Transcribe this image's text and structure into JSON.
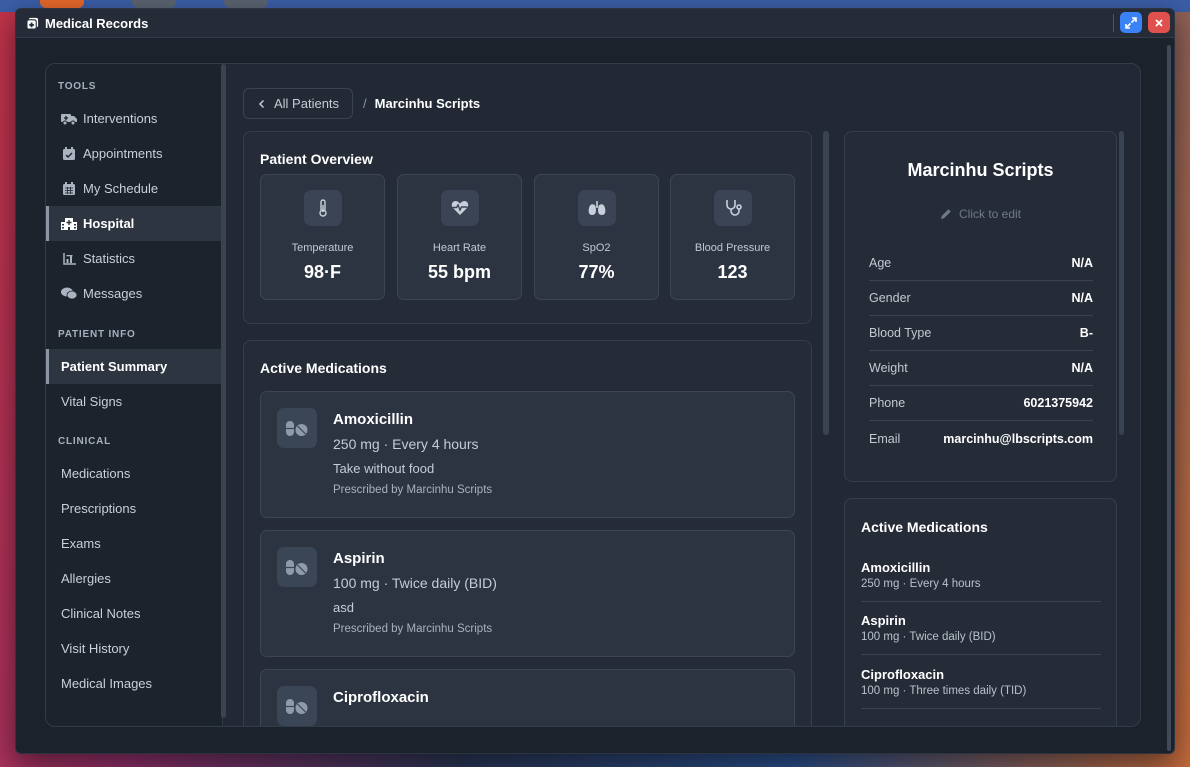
{
  "window": {
    "title": "Medical Records"
  },
  "sidebar": {
    "sections": [
      {
        "title": "TOOLS",
        "items": [
          {
            "label": "Interventions",
            "icon": "ambulance-icon"
          },
          {
            "label": "Appointments",
            "icon": "calendar-check-icon"
          },
          {
            "label": "My Schedule",
            "icon": "calendar-icon"
          },
          {
            "label": "Hospital",
            "icon": "hospital-icon"
          },
          {
            "label": "Statistics",
            "icon": "chart-icon"
          },
          {
            "label": "Messages",
            "icon": "chat-icon"
          }
        ]
      },
      {
        "title": "PATIENT INFO",
        "items": [
          {
            "label": "Patient Summary"
          },
          {
            "label": "Vital Signs"
          }
        ]
      },
      {
        "title": "CLINICAL",
        "items": [
          {
            "label": "Medications"
          },
          {
            "label": "Prescriptions"
          },
          {
            "label": "Exams"
          },
          {
            "label": "Allergies"
          },
          {
            "label": "Clinical Notes"
          },
          {
            "label": "Visit History"
          },
          {
            "label": "Medical Images"
          }
        ]
      }
    ]
  },
  "breadcrumb": {
    "back_label": "All Patients",
    "separator": "/",
    "current": "Marcinhu Scripts"
  },
  "overview": {
    "title": "Patient Overview",
    "vitals": [
      {
        "label": "Temperature",
        "value": "98·F",
        "icon": "thermometer-icon"
      },
      {
        "label": "Heart Rate",
        "value": "55 bpm",
        "icon": "heart-pulse-icon"
      },
      {
        "label": "SpO2",
        "value": "77%",
        "icon": "lungs-icon"
      },
      {
        "label": "Blood Pressure",
        "value": "123",
        "icon": "stethoscope-icon"
      }
    ]
  },
  "medications": {
    "title": "Active Medications",
    "items": [
      {
        "name": "Amoxicillin",
        "dose": "250 mg · Every 4 hours",
        "instructions": "Take without food",
        "prescriber": "Prescribed by Marcinhu Scripts"
      },
      {
        "name": "Aspirin",
        "dose": "100 mg · Twice daily (BID)",
        "instructions": "asd",
        "prescriber": "Prescribed by Marcinhu Scripts"
      },
      {
        "name": "Ciprofloxacin",
        "dose": "",
        "instructions": "",
        "prescriber": ""
      }
    ]
  },
  "patient": {
    "name": "Marcinhu Scripts",
    "edit_hint": "Click to edit",
    "fields": [
      {
        "key": "Age",
        "value": "N/A"
      },
      {
        "key": "Gender",
        "value": "N/A"
      },
      {
        "key": "Blood Type",
        "value": "B-"
      },
      {
        "key": "Weight",
        "value": "N/A"
      },
      {
        "key": "Phone",
        "value": "6021375942"
      },
      {
        "key": "Email",
        "value": "marcinhu@lbscripts.com"
      }
    ]
  },
  "summary_meds": {
    "title": "Active Medications",
    "items": [
      {
        "name": "Amoxicillin",
        "detail": "250 mg · Every 4 hours"
      },
      {
        "name": "Aspirin",
        "detail": "100 mg · Twice daily (BID)"
      },
      {
        "name": "Ciprofloxacin",
        "detail": "100 mg · Three times daily (TID)"
      }
    ]
  }
}
